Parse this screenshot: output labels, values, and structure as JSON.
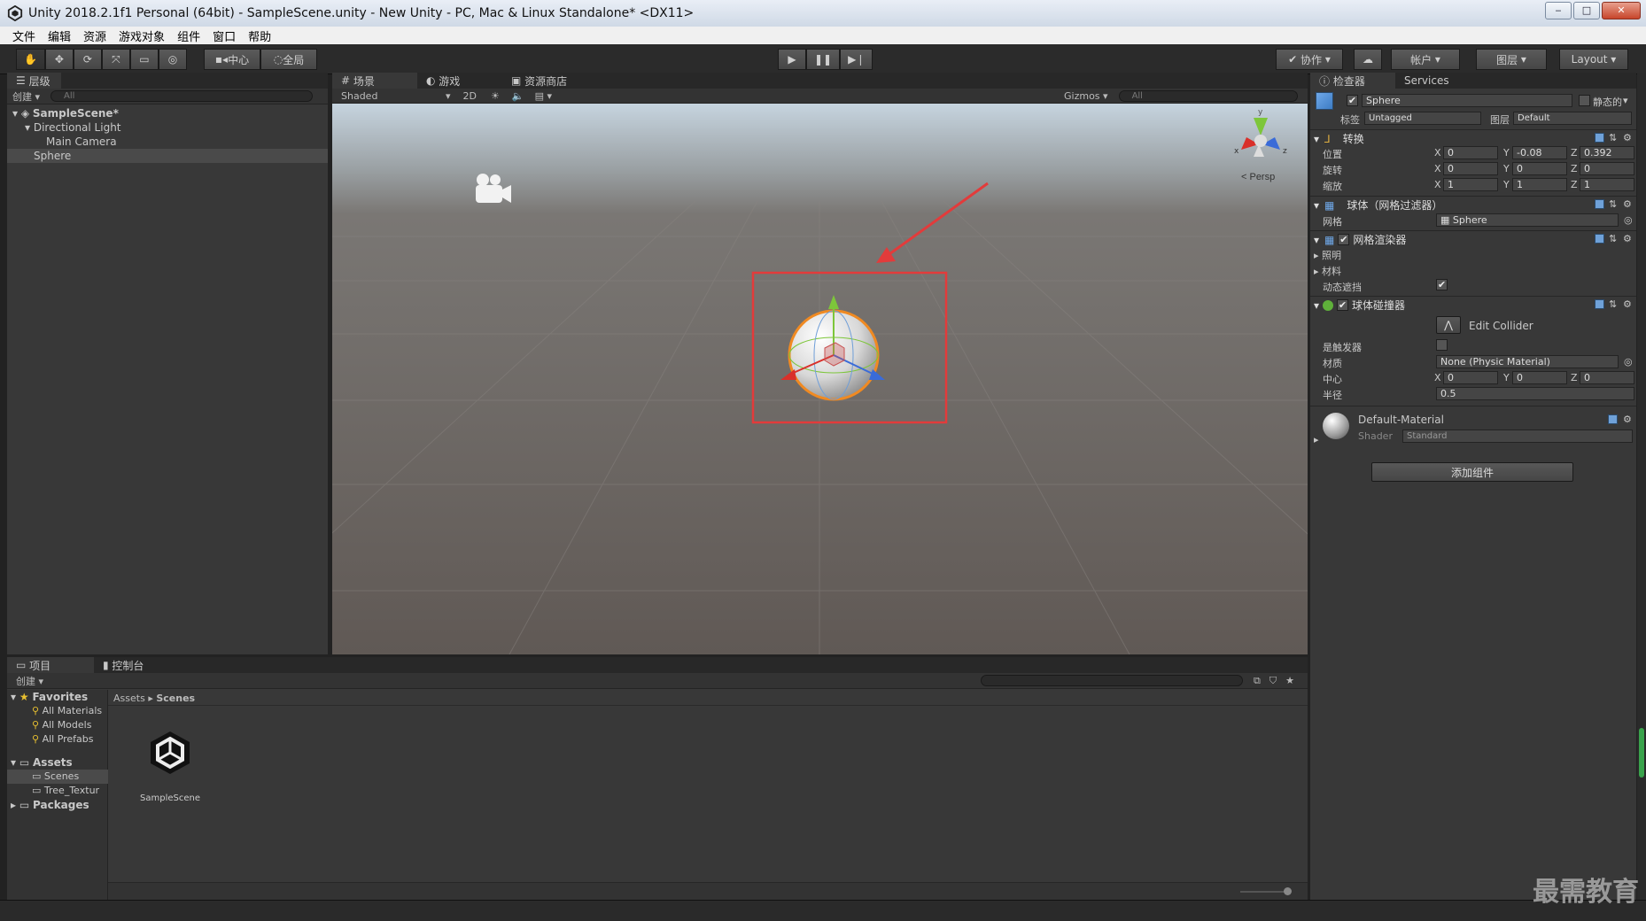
{
  "window": {
    "title": "Unity 2018.2.1f1 Personal (64bit) - SampleScene.unity - New Unity - PC, Mac & Linux Standalone* <DX11>"
  },
  "menu": [
    "文件",
    "编辑",
    "资源",
    "游戏对象",
    "组件",
    "窗口",
    "帮助"
  ],
  "toolbar": {
    "pivot": "中心",
    "global": "全局",
    "collab": "协作",
    "account": "帐户",
    "layers": "图层",
    "layout": "Layout"
  },
  "hierarchy": {
    "tab": "层级",
    "create": "创建",
    "search_placeholder": "All",
    "scene": "SampleScene*",
    "items": [
      "Directional Light",
      "Main Camera",
      "Sphere"
    ]
  },
  "scene_view": {
    "tabs": [
      "场景",
      "游戏",
      "资源商店"
    ],
    "shading": "Shaded",
    "mode2d": "2D",
    "gizmos": "Gizmos",
    "search_placeholder": "All",
    "persp": "< Persp",
    "gizmo_axes": {
      "x": "x",
      "y": "y",
      "z": "z"
    }
  },
  "inspector": {
    "tabs": [
      "检查器",
      "Services"
    ],
    "object_name": "Sphere",
    "static_label": "静态的",
    "tag_label": "标签",
    "tag_value": "Untagged",
    "layer_label": "图层",
    "layer_value": "Default",
    "transform": {
      "title": "转换",
      "position_label": "位置",
      "rotation_label": "旋转",
      "scale_label": "缩放",
      "position": [
        "0",
        "-0.08",
        "0.392"
      ],
      "rotation": [
        "0",
        "0",
        "0"
      ],
      "scale": [
        "1",
        "1",
        "1"
      ]
    },
    "mesh_filter": {
      "title": "球体（网格过滤器）",
      "mesh_label": "网格",
      "mesh_value": "Sphere"
    },
    "mesh_renderer": {
      "title": "网格渲染器",
      "lighting_label": "照明",
      "materials_label": "材料",
      "dynamic_occluded_label": "动态遮挡"
    },
    "sphere_collider": {
      "title": "球体碰撞器",
      "edit_collider": "Edit Collider",
      "is_trigger_label": "是触发器",
      "material_label": "材质",
      "material_value": "None (Physic Material)",
      "center_label": "中心",
      "center": [
        "0",
        "0",
        "0"
      ],
      "radius_label": "半径",
      "radius": "0.5"
    },
    "material": {
      "name": "Default-Material",
      "shader_label": "Shader",
      "shader_value": "Standard"
    },
    "add_component": "添加组件"
  },
  "project": {
    "tabs": [
      "项目",
      "控制台"
    ],
    "create": "创建",
    "favorites_label": "Favorites",
    "favorites": [
      "All Materials",
      "All Models",
      "All Prefabs"
    ],
    "assets_label": "Assets",
    "assets_children": [
      "Scenes",
      "Tree_Textur"
    ],
    "packages_label": "Packages",
    "breadcrumb": [
      "Assets",
      "Scenes"
    ],
    "files": [
      "SampleScene"
    ]
  },
  "watermark": "最需教育",
  "colors": {
    "highlight_box": "#e23b3b",
    "arrow": "#e23b3b",
    "sphere_outline": "#f08a22"
  }
}
